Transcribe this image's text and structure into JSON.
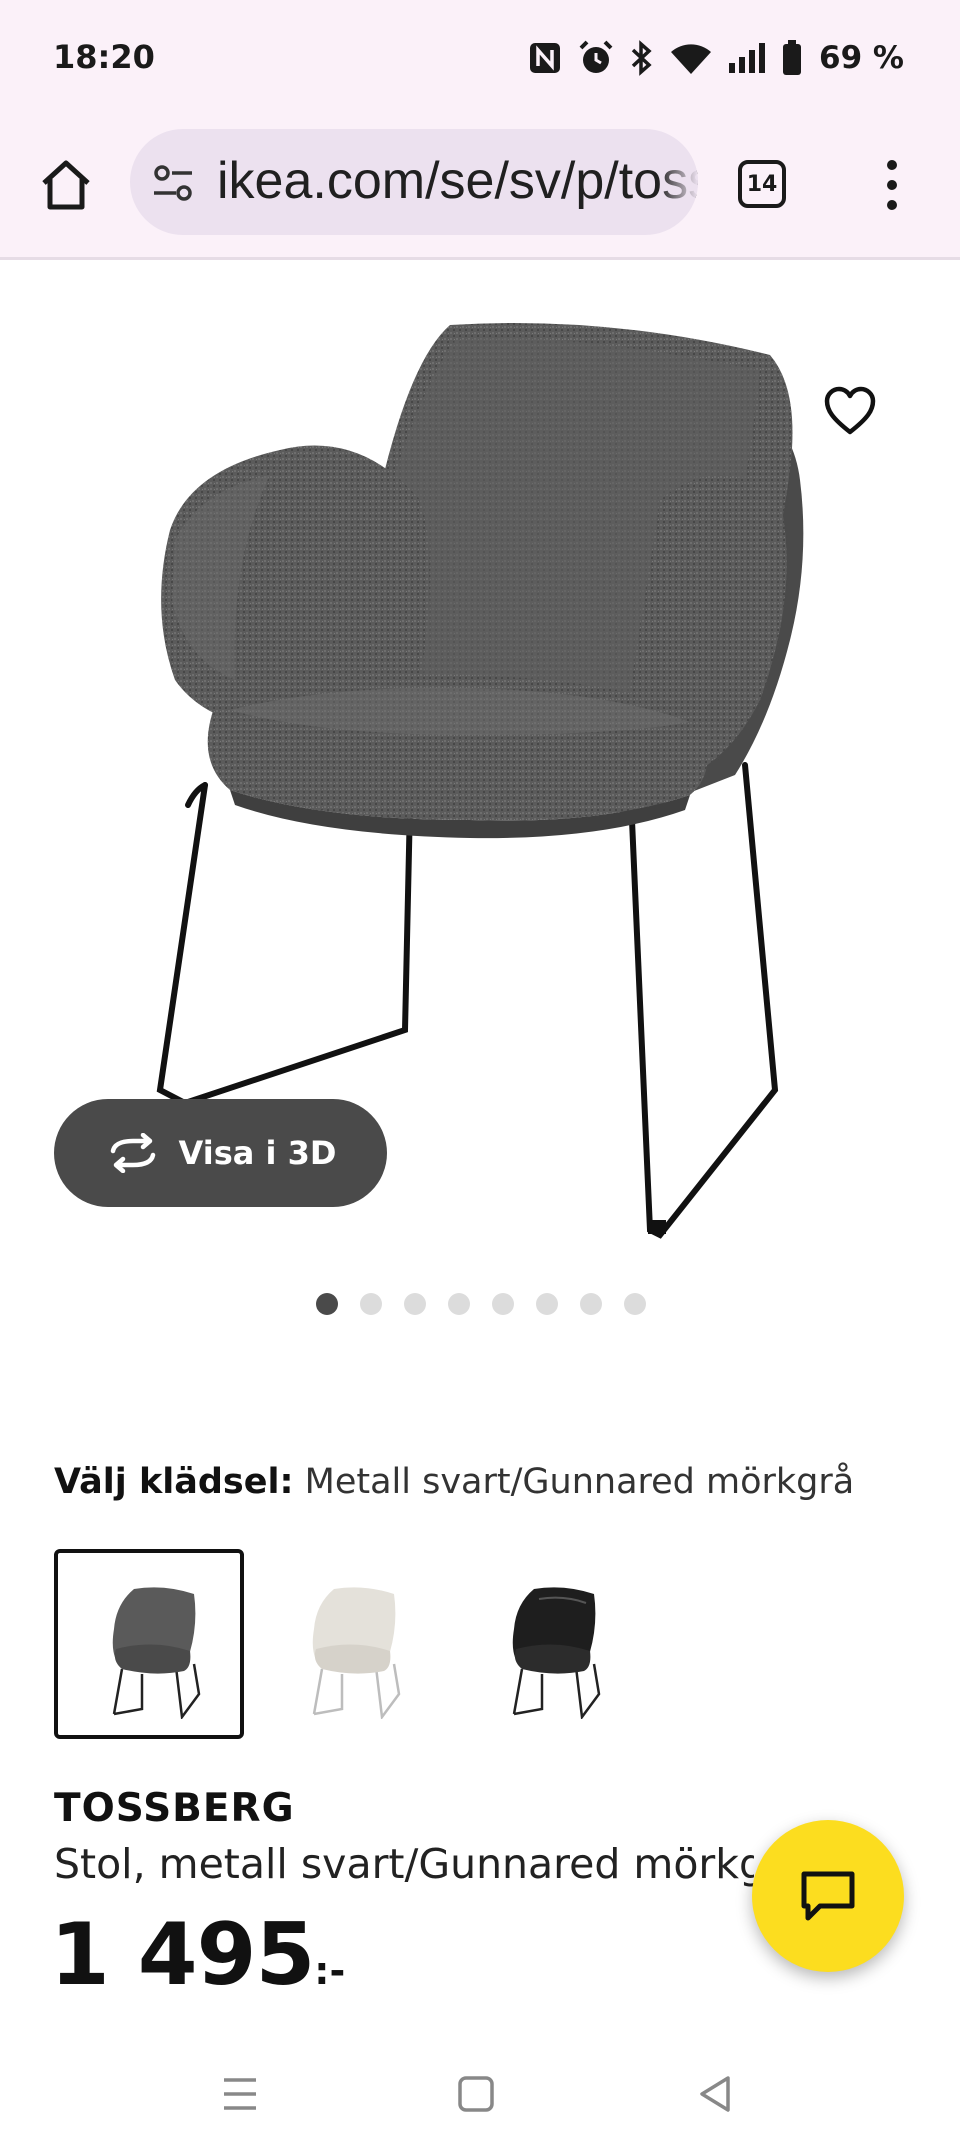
{
  "status_bar": {
    "time": "18:20",
    "battery": "69 %",
    "icons": [
      "nfc-icon",
      "alarm-icon",
      "bluetooth-icon",
      "wifi-icon",
      "signal-icon",
      "battery-icon"
    ]
  },
  "browser": {
    "url": "ikea.com/se/sv/p/tossberg",
    "tab_count": "14"
  },
  "product_gallery": {
    "view_3d_label": "Visa i 3D",
    "image_count": 8,
    "active_image_index": 0
  },
  "variant_picker": {
    "label": "Välj klädsel:",
    "selected_value": "Metall svart/Gunnared mörkgrå",
    "swatches": [
      {
        "name": "dark-grey",
        "seat_color": "#5a5a5a",
        "leg_color": "#222222"
      },
      {
        "name": "beige",
        "seat_color": "#e4e1da",
        "leg_color": "#bdbdbd"
      },
      {
        "name": "black",
        "seat_color": "#1e1e1e",
        "leg_color": "#222222"
      }
    ]
  },
  "product": {
    "name": "TOSSBERG",
    "description": "Stol, metall svart/Gunnared mörkgrå",
    "price": "1 495",
    "price_suffix": ":-"
  },
  "colors": {
    "chat_button": "#fcdd1f",
    "browser_bar": "#fbf1f9",
    "url_bar": "#ece1ef",
    "view_3d_button": "#4a4a4a"
  }
}
